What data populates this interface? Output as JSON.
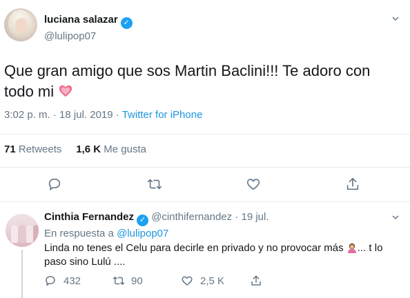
{
  "tweet": {
    "author_name": "luciana salazar",
    "author_handle": "@lulipop07",
    "text": "Que gran amigo que sos Martin Baclini!!! Te adoro con todo mi",
    "emoji": "heart-emoji",
    "time": "3:02 p. m.",
    "dot": "·",
    "date": "18 jul. 2019",
    "source": "Twitter for iPhone",
    "retweets_count": "71",
    "retweets_label": "Retweets",
    "likes_count": "1,6 K",
    "likes_label": "Me gusta"
  },
  "reply": {
    "author_name": "Cinthia Fernandez",
    "author_handle": "@cinthifernandez",
    "dot": "·",
    "date": "19 jul.",
    "in_reply_prefix": "En respuesta a",
    "in_reply_handle": "@lulipop07",
    "text_part1": "Linda no tenes el Celu para decirle en privado y no provocar más",
    "text_part2": "... t lo paso sino Lulú ....",
    "replies": "432",
    "retweets": "90",
    "likes": "2,5 K"
  },
  "colors": {
    "accent": "#1da1f2",
    "link": "#1b95e0",
    "muted": "#657786",
    "divider": "#e6ecf0"
  }
}
